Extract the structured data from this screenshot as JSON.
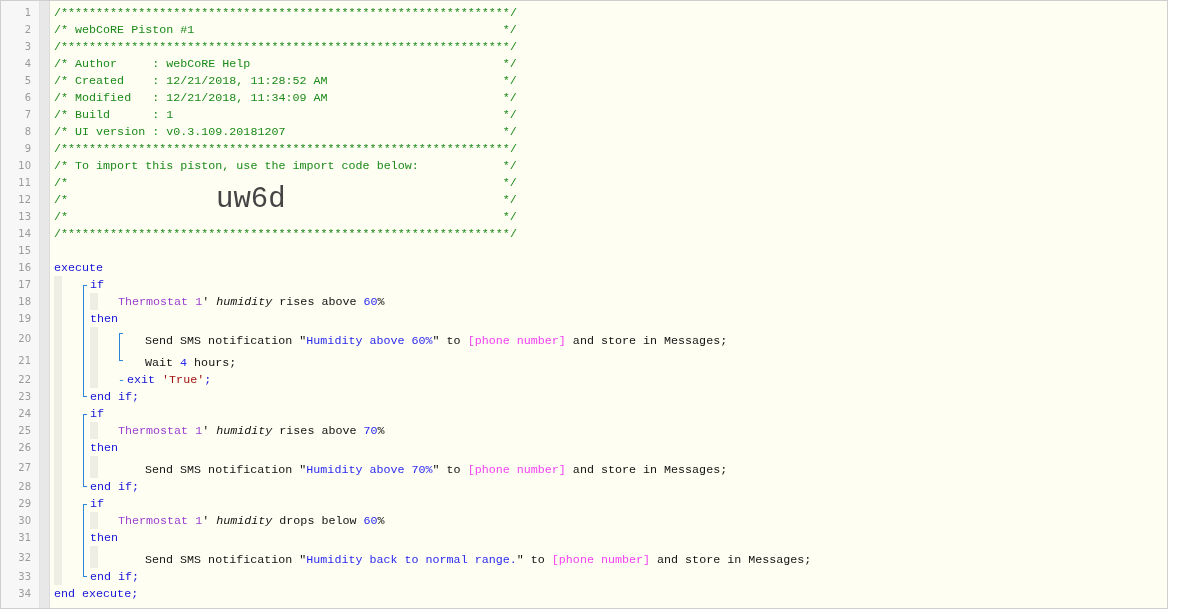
{
  "lines": [
    {
      "n": "1",
      "kind": "comment",
      "tokens": [
        {
          "text": "/****************************************************************/",
          "kind": "comment"
        }
      ]
    },
    {
      "n": "2",
      "kind": "comment",
      "tokens": [
        {
          "text": "/* webCoRE Piston #1",
          "kind": "comment"
        },
        {
          "text": "*/",
          "kind": "comment-end"
        }
      ]
    },
    {
      "n": "3",
      "kind": "comment",
      "tokens": [
        {
          "text": "/****************************************************************/",
          "kind": "comment"
        }
      ]
    },
    {
      "n": "4",
      "kind": "comment",
      "tokens": [
        {
          "text": "/* Author     : webCoRE Help",
          "kind": "comment"
        },
        {
          "text": "*/",
          "kind": "comment-end"
        }
      ]
    },
    {
      "n": "5",
      "kind": "comment",
      "tokens": [
        {
          "text": "/* Created    : 12/21/2018, 11:28:52 AM",
          "kind": "comment"
        },
        {
          "text": "*/",
          "kind": "comment-end"
        }
      ]
    },
    {
      "n": "6",
      "kind": "comment",
      "tokens": [
        {
          "text": "/* Modified   : 12/21/2018, 11:34:09 AM",
          "kind": "comment"
        },
        {
          "text": "*/",
          "kind": "comment-end"
        }
      ]
    },
    {
      "n": "7",
      "kind": "comment",
      "tokens": [
        {
          "text": "/* Build      : 1",
          "kind": "comment"
        },
        {
          "text": "*/",
          "kind": "comment-end"
        }
      ]
    },
    {
      "n": "8",
      "kind": "comment",
      "tokens": [
        {
          "text": "/* UI version : v0.3.109.20181207",
          "kind": "comment"
        },
        {
          "text": "*/",
          "kind": "comment-end"
        }
      ]
    },
    {
      "n": "9",
      "kind": "comment",
      "tokens": [
        {
          "text": "/****************************************************************/",
          "kind": "comment"
        }
      ]
    },
    {
      "n": "10",
      "kind": "comment",
      "tokens": [
        {
          "text": "/* To import this piston, use the import code below:",
          "kind": "comment"
        },
        {
          "text": "*/",
          "kind": "comment-end"
        }
      ]
    },
    {
      "n": "11",
      "kind": "comment",
      "tokens": [
        {
          "text": "/*",
          "kind": "comment"
        },
        {
          "text": "*/",
          "kind": "comment-end"
        }
      ]
    },
    {
      "n": "12",
      "kind": "comment",
      "tokens": [
        {
          "text": "/*",
          "kind": "comment"
        },
        {
          "text": "uw6d",
          "kind": "import-code"
        },
        {
          "text": "*/",
          "kind": "comment-end"
        }
      ]
    },
    {
      "n": "13",
      "kind": "comment",
      "tokens": [
        {
          "text": "/*",
          "kind": "comment"
        },
        {
          "text": "*/",
          "kind": "comment-end"
        }
      ]
    },
    {
      "n": "14",
      "kind": "comment",
      "tokens": [
        {
          "text": "/****************************************************************/",
          "kind": "comment"
        }
      ]
    },
    {
      "n": "15",
      "kind": "blank"
    },
    {
      "n": "16",
      "kind": "root",
      "tokens": [
        {
          "text": "execute",
          "kind": "keyword"
        }
      ]
    },
    {
      "n": "17",
      "kind": "clause",
      "block_open": true,
      "block_close": false,
      "tokens": [
        {
          "text": "if",
          "kind": "keyword"
        }
      ]
    },
    {
      "n": "18",
      "kind": "condition",
      "block_open": false,
      "block_close": false,
      "tokens": [
        {
          "text": "Thermostat 1",
          "kind": "device"
        },
        {
          "text": "' ",
          "kind": "plain"
        },
        {
          "text": "humidity",
          "kind": "attribute"
        },
        {
          "text": " rises above ",
          "kind": "plain"
        },
        {
          "text": "60",
          "kind": "number"
        },
        {
          "text": "%",
          "kind": "plain"
        }
      ]
    },
    {
      "n": "19",
      "kind": "clause",
      "block_open": false,
      "block_close": false,
      "tokens": [
        {
          "text": "then",
          "kind": "keyword"
        }
      ]
    },
    {
      "n": "20",
      "kind": "action",
      "block_open": false,
      "block_close": false,
      "group_open": true,
      "group_close": false,
      "tokens": [
        {
          "text": "Send SMS notification \"",
          "kind": "plain"
        },
        {
          "text": "Humidity above 60%",
          "kind": "string"
        },
        {
          "text": "\" to ",
          "kind": "plain"
        },
        {
          "text": "[phone number]",
          "kind": "variable"
        },
        {
          "text": " and store in Messages;",
          "kind": "plain"
        }
      ]
    },
    {
      "n": "21",
      "kind": "action",
      "block_open": false,
      "block_close": false,
      "group_open": false,
      "group_close": true,
      "tokens": [
        {
          "text": "Wait ",
          "kind": "plain"
        },
        {
          "text": "4",
          "kind": "number"
        },
        {
          "text": " hours;",
          "kind": "plain"
        }
      ]
    },
    {
      "n": "22",
      "kind": "exit",
      "block_open": false,
      "block_close": false,
      "tokens": [
        {
          "text": "-",
          "kind": "marker"
        },
        {
          "text": "exit ",
          "kind": "keyword"
        },
        {
          "text": "'True'",
          "kind": "literal"
        },
        {
          "text": ";",
          "kind": "keyword"
        }
      ]
    },
    {
      "n": "23",
      "kind": "clause",
      "block_open": false,
      "block_close": true,
      "tokens": [
        {
          "text": "end if;",
          "kind": "keyword"
        }
      ]
    },
    {
      "n": "24",
      "kind": "clause",
      "block_open": true,
      "block_close": false,
      "tokens": [
        {
          "text": "if",
          "kind": "keyword"
        }
      ]
    },
    {
      "n": "25",
      "kind": "condition",
      "block_open": false,
      "block_close": false,
      "tokens": [
        {
          "text": "Thermostat 1",
          "kind": "device"
        },
        {
          "text": "' ",
          "kind": "plain"
        },
        {
          "text": "humidity",
          "kind": "attribute"
        },
        {
          "text": " rises above ",
          "kind": "plain"
        },
        {
          "text": "70",
          "kind": "number"
        },
        {
          "text": "%",
          "kind": "plain"
        }
      ]
    },
    {
      "n": "26",
      "kind": "clause",
      "block_open": false,
      "block_close": false,
      "tokens": [
        {
          "text": "then",
          "kind": "keyword"
        }
      ]
    },
    {
      "n": "27",
      "kind": "action",
      "block_open": false,
      "block_close": false,
      "group_open": false,
      "group_close": false,
      "tokens": [
        {
          "text": "Send SMS notification \"",
          "kind": "plain"
        },
        {
          "text": "Humidity above 70%",
          "kind": "string"
        },
        {
          "text": "\" to ",
          "kind": "plain"
        },
        {
          "text": "[phone number]",
          "kind": "variable"
        },
        {
          "text": " and store in Messages;",
          "kind": "plain"
        }
      ]
    },
    {
      "n": "28",
      "kind": "clause",
      "block_open": false,
      "block_close": true,
      "tokens": [
        {
          "text": "end if;",
          "kind": "keyword"
        }
      ]
    },
    {
      "n": "29",
      "kind": "clause",
      "block_open": true,
      "block_close": false,
      "tokens": [
        {
          "text": "if",
          "kind": "keyword"
        }
      ]
    },
    {
      "n": "30",
      "kind": "condition",
      "block_open": false,
      "block_close": false,
      "tokens": [
        {
          "text": "Thermostat 1",
          "kind": "device"
        },
        {
          "text": "' ",
          "kind": "plain"
        },
        {
          "text": "humidity",
          "kind": "attribute"
        },
        {
          "text": " drops below ",
          "kind": "plain"
        },
        {
          "text": "60",
          "kind": "number"
        },
        {
          "text": "%",
          "kind": "plain"
        }
      ]
    },
    {
      "n": "31",
      "kind": "clause",
      "block_open": false,
      "block_close": false,
      "tokens": [
        {
          "text": "then",
          "kind": "keyword"
        }
      ]
    },
    {
      "n": "32",
      "kind": "action",
      "block_open": false,
      "block_close": false,
      "group_open": false,
      "group_close": false,
      "tokens": [
        {
          "text": "Send SMS notification \"",
          "kind": "plain"
        },
        {
          "text": "Humidity back to normal range.",
          "kind": "string"
        },
        {
          "text": "\" to ",
          "kind": "plain"
        },
        {
          "text": "[phone number]",
          "kind": "variable"
        },
        {
          "text": " and store in Messages;",
          "kind": "plain"
        }
      ]
    },
    {
      "n": "33",
      "kind": "clause",
      "block_open": false,
      "block_close": true,
      "tokens": [
        {
          "text": "end if;",
          "kind": "keyword"
        }
      ]
    },
    {
      "n": "34",
      "kind": "root",
      "tokens": [
        {
          "text": "end execute;",
          "kind": "keyword"
        }
      ]
    }
  ]
}
